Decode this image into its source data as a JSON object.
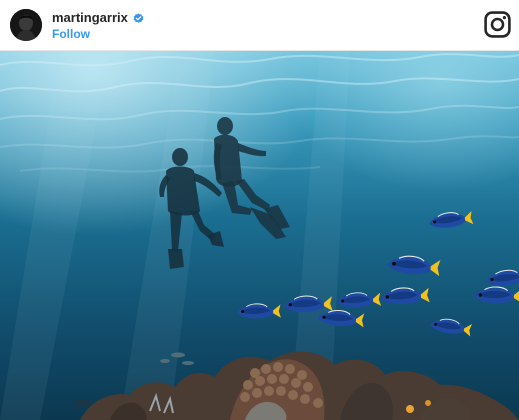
{
  "post": {
    "username": "martingarrix",
    "verified": true,
    "follow_label": "Follow",
    "logo_icon": "instagram-icon",
    "verified_icon": "verified-badge-icon",
    "photo_subject": "underwater-snorkelers-with-fish-and-coral"
  },
  "colors": {
    "follow_link": "#3897f0",
    "username": "#262626",
    "verified_badge": "#3897f0",
    "header_border": "#e6e6e6",
    "water_surface": "#6fc2dc",
    "water_deep": "#0d3f5c",
    "fish_body": "#1f4aa3",
    "fish_stripe": "#f1c21d"
  }
}
